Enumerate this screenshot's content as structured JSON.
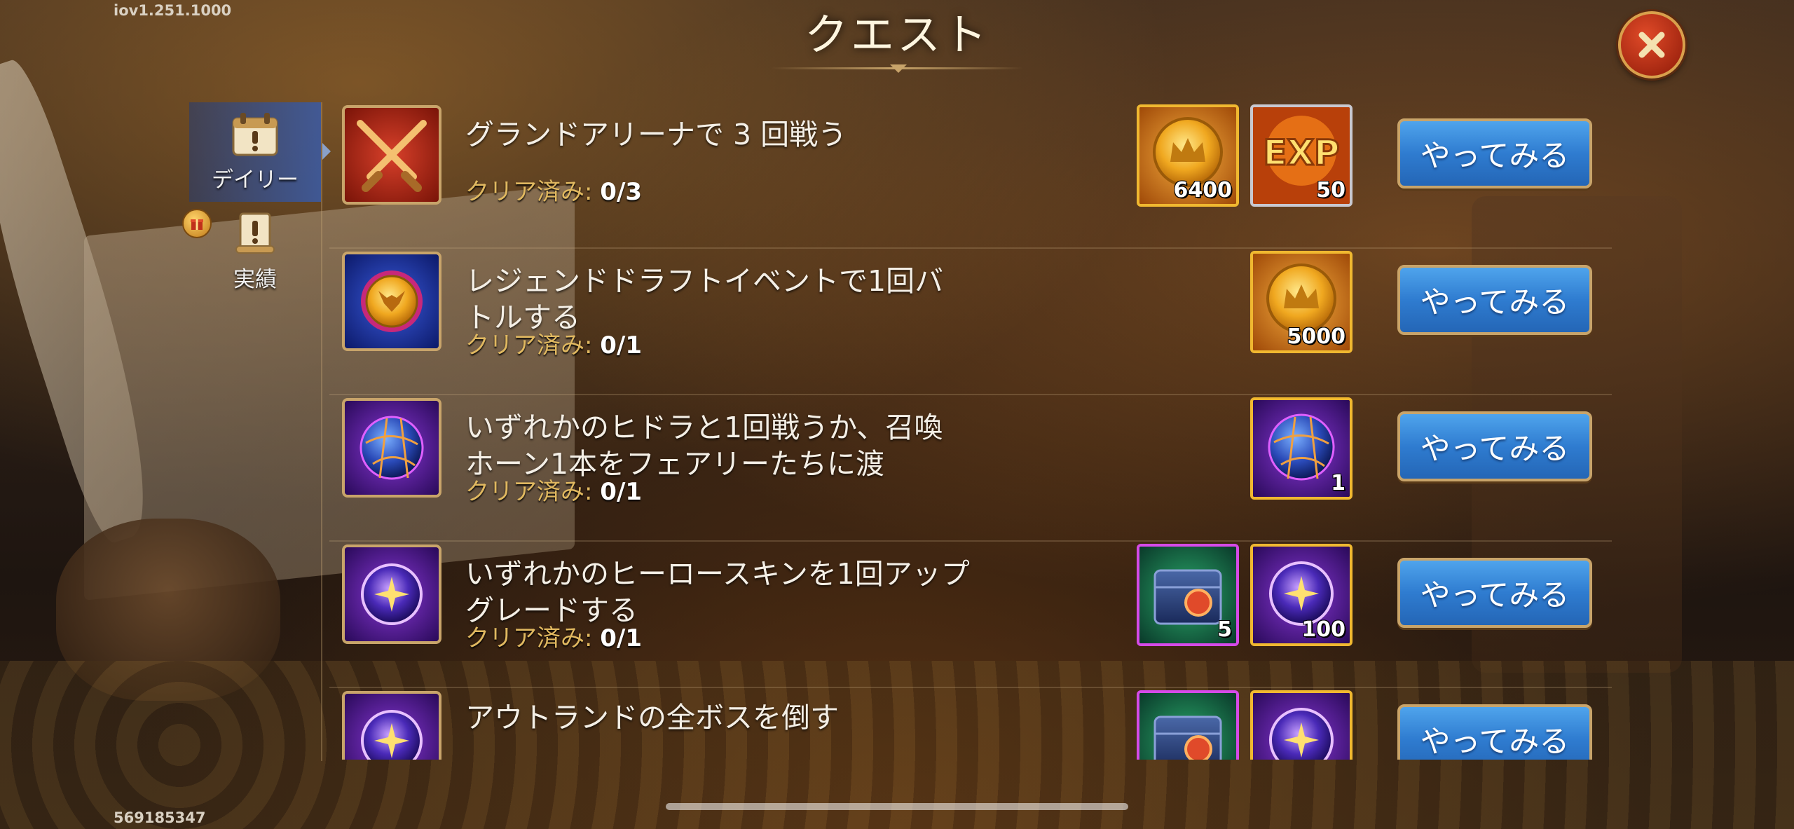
{
  "version": "iov1.251.1000",
  "player_id": "569185347",
  "title": "クエスト",
  "sidebar": {
    "tabs": [
      {
        "label": "デイリー",
        "icon": "daily-calendar-icon",
        "active": true
      },
      {
        "label": "実績",
        "icon": "achievement-scroll-icon",
        "active": false
      }
    ]
  },
  "quests": [
    {
      "title": "グランドアリーナで 3 回戦う",
      "progress_label": "クリア済み:",
      "progress": "0/3",
      "icon": "crossed-swords-icon",
      "rewards": [
        {
          "icon": "gold-coin-icon",
          "count": "6400",
          "frame": "gold"
        },
        {
          "icon": "exp-icon",
          "count": "50",
          "frame": "silver"
        }
      ],
      "button": "やってみる"
    },
    {
      "title": "レジェンドドラフトイベントで1回バトルする",
      "progress_label": "クリア済み:",
      "progress": "0/1",
      "icon": "fox-medallion-icon",
      "rewards": [
        {
          "icon": "gold-coin-icon",
          "count": "5000",
          "frame": "gold"
        }
      ],
      "button": "やってみる"
    },
    {
      "title": "いずれかのヒドラと1回戦うか、召喚ホーン1本をフェアリーたちに渡",
      "progress_label": "クリア済み:",
      "progress": "0/1",
      "icon": "hydra-orb-icon",
      "rewards": [
        {
          "icon": "hydra-orb-icon",
          "count": "1",
          "frame": "gold"
        }
      ],
      "button": "やってみる"
    },
    {
      "title": "いずれかのヒーロースキンを1回アップグレードする",
      "progress_label": "クリア済み:",
      "progress": "0/1",
      "icon": "skin-stone-icon",
      "rewards": [
        {
          "icon": "skin-chest-icon",
          "count": "5",
          "frame": "purple"
        },
        {
          "icon": "skin-stone-icon",
          "count": "100",
          "frame": "gold"
        }
      ],
      "button": "やってみる"
    },
    {
      "title": "アウトランドの全ボスを倒す",
      "progress_label": "",
      "progress": "",
      "icon": "skin-stone-icon",
      "rewards": [
        {
          "icon": "skin-chest-icon",
          "count": "",
          "frame": "purple"
        },
        {
          "icon": "skin-stone-icon",
          "count": "",
          "frame": "gold"
        }
      ],
      "button": "やってみる"
    }
  ]
}
